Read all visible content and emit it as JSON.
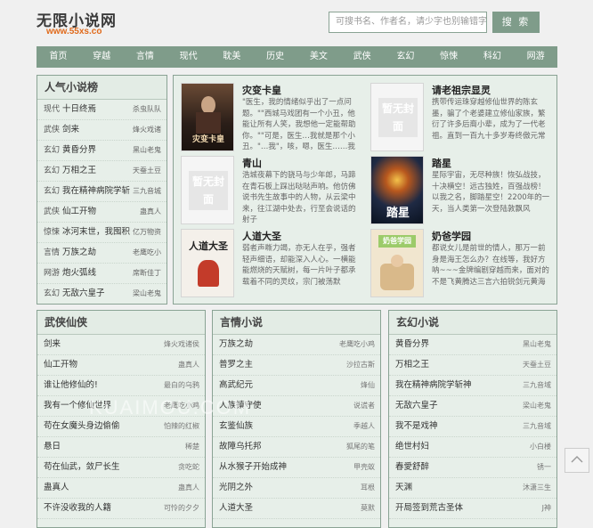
{
  "site": {
    "title": "无限小说网",
    "url": "www.55xs.co"
  },
  "search": {
    "placeholder": "可搜书名、作者名，请少字也别输错字",
    "button": "搜 索"
  },
  "nav": [
    "首页",
    "穿越",
    "言情",
    "现代",
    "耽美",
    "历史",
    "美文",
    "武侠",
    "玄幻",
    "惊悚",
    "科幻",
    "网游"
  ],
  "ranking": {
    "title": "人气小说榜",
    "items": [
      {
        "cat": "现代",
        "title": "十日终焉",
        "author": "杀虫队队"
      },
      {
        "cat": "武侠",
        "title": "剑来",
        "author": "烽火戏诸"
      },
      {
        "cat": "玄幻",
        "title": "黄昏分界",
        "author": "黑山老鬼"
      },
      {
        "cat": "玄幻",
        "title": "万相之王",
        "author": "天蚕土豆"
      },
      {
        "cat": "玄幻",
        "title": "我在精神病院学斩",
        "author": "三九音城"
      },
      {
        "cat": "武侠",
        "title": "仙工开物",
        "author": "蛊真人"
      },
      {
        "cat": "惊悚",
        "title": "冰河末世，我囤积",
        "author": "亿万物资"
      },
      {
        "cat": "言情",
        "title": "万族之劫",
        "author": "老鹰吃小"
      },
      {
        "cat": "网游",
        "title": "炮火弧线",
        "author": "席断佳丁"
      },
      {
        "cat": "玄幻",
        "title": "无敌六皇子",
        "author": "梁山老鬼"
      }
    ]
  },
  "featured": [
    {
      "title": "灾变卡皇",
      "cover": "灾变卡皇",
      "desc": "\"医生，我的情绪似乎出了一点问题。\"\"西城马戏团有一个小丑，他能让所有人笑，我想他一定能帮助你。\"\"可是，医生…我就是那个小丑。\"…我\"，咳，嗯，医生……我害…"
    },
    {
      "title": "请老祖宗显灵",
      "cover": "暂无封面",
      "desc": "携带传运珠穿越修仙世界的陈玄墨，骗了个老婆建立修仙家族，繁衍了许多后裔小辈，成为了一代老祖。直到一百九十多岁寿终傲元常"
    },
    {
      "title": "青山",
      "cover": "暂无封面",
      "desc": "浩城夜幕下的骁马与少年郎，马蹄在青石板上踩出哒哒声响。他仿佛说书先生故事中的人物，从云梁中来，往江湖中处去，行至会说话的射子"
    },
    {
      "title": "踏星",
      "cover": "踏星",
      "desc": "星际宇宙，无尽种族！恢弘战技，十决横空！远古独姓，百强战榜！以我之名，脚踏星空！2200年的一天，当人类第一次登陆敦飘风"
    },
    {
      "title": "人道大圣",
      "cover": "人道大圣",
      "desc": "弱者声嘶力竭，亦无人在乎，强者轻声细语，却能深入人心。一横能能燃烧的天赋树，每一片叶子都承载着不同的灵纹，宗门被荡默"
    },
    {
      "title": "奶爸学园",
      "cover": "奶爸学园",
      "desc": "都说女儿是前世的情人，那万一前身是海王怎么办？在线等，我好方呐~~~金牌编剧穿越而来，面对的不是飞黄腾达三言六拍锐剑元黄海"
    }
  ],
  "lists": [
    {
      "title": "武侠仙侠",
      "items": [
        {
          "title": "剑来",
          "author": "烽火戏诸侯"
        },
        {
          "title": "仙工开物",
          "author": "蛊真人"
        },
        {
          "title": "谁让他修仙的!",
          "author": "最白的乌鸦"
        },
        {
          "title": "我有一个修仙世界",
          "author": "老鹰吃小鸡"
        },
        {
          "title": "苟在女魔头身边偷偷",
          "author": "怕辣的红椒"
        },
        {
          "title": "悬日",
          "author": "稀楚"
        },
        {
          "title": "苟在仙武，敛尸长生",
          "author": "贪吃蛇"
        },
        {
          "title": "蛊真人",
          "author": "蛊真人"
        },
        {
          "title": "不许没收我的人籍",
          "author": "可怜的夕夕"
        }
      ]
    },
    {
      "title": "言情小说",
      "items": [
        {
          "title": "万族之劫",
          "author": "老鹰吃小鸡"
        },
        {
          "title": "普罗之主",
          "author": "沙拉古斯"
        },
        {
          "title": "高武纪元",
          "author": "烽仙"
        },
        {
          "title": "人族镇守使",
          "author": "说谎者"
        },
        {
          "title": "玄鉴仙族",
          "author": "季越人"
        },
        {
          "title": "故障乌托邦",
          "author": "狐尾的笔"
        },
        {
          "title": "从水猴子开始成神",
          "author": "甲壳蚁"
        },
        {
          "title": "光阴之外",
          "author": "耳根"
        },
        {
          "title": "人道大圣",
          "author": "莫默"
        }
      ]
    },
    {
      "title": "玄幻小说",
      "items": [
        {
          "title": "黄昏分界",
          "author": "黑山老鬼"
        },
        {
          "title": "万相之王",
          "author": "天蚕土豆"
        },
        {
          "title": "我在精神病院学斩神",
          "author": "三九音域"
        },
        {
          "title": "无敌六皇子",
          "author": "梁山老鬼"
        },
        {
          "title": "我不是戏神",
          "author": "三九音域"
        },
        {
          "title": "绝世村妇",
          "author": "小白楼"
        },
        {
          "title": "春愛舒醉",
          "author": "锈一"
        },
        {
          "title": "天渊",
          "author": "沐潇三生"
        },
        {
          "title": "开局签到荒古圣体",
          "author": "J神"
        }
      ]
    }
  ],
  "watermark": "KUAIMOU.COM",
  "totop_icon": "chevron-up-icon"
}
